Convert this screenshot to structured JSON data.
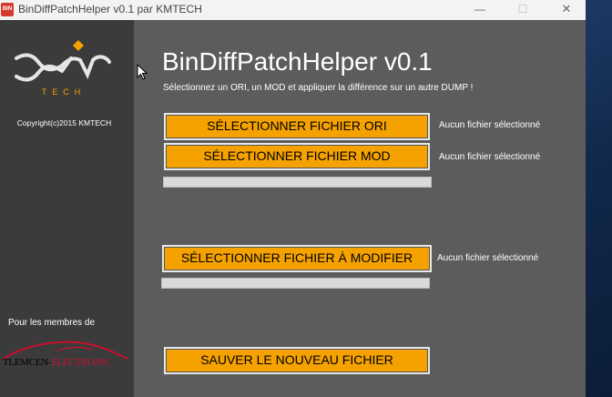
{
  "window": {
    "title": "BinDiffPatchHelper v0.1 par KMTECH",
    "icon_text": "BIN"
  },
  "sidebar": {
    "logo_text": "TECH",
    "copyright": "Copyright(c)2015 KMTECH",
    "members_label": "Pour les membres de",
    "partner": {
      "part1": "TLEMCEN-",
      "part2": "ELECTRONIC"
    }
  },
  "main": {
    "title": "BinDiffPatchHelper v0.1",
    "subtitle": "Sélectionnez un ORI, un MOD et appliquer la différence sur un autre DUMP !",
    "ori": {
      "button": "SÉLECTIONNER FICHIER ORI",
      "status": "Aucun fichier sélectionné"
    },
    "mod": {
      "button": "SÉLECTIONNER FICHIER MOD",
      "status": "Aucun fichier sélectionné",
      "progress": 0
    },
    "target": {
      "button": "SÉLECTIONNER FICHIER À MODIFIER",
      "status": "Aucun fichier sélectionné",
      "progress": 0
    },
    "save": {
      "button": "SAUVER LE NOUVEAU FICHIER"
    }
  },
  "colors": {
    "accent": "#f5a200",
    "sidebar": "#3b3b3b",
    "panel": "#5c5c5c"
  }
}
